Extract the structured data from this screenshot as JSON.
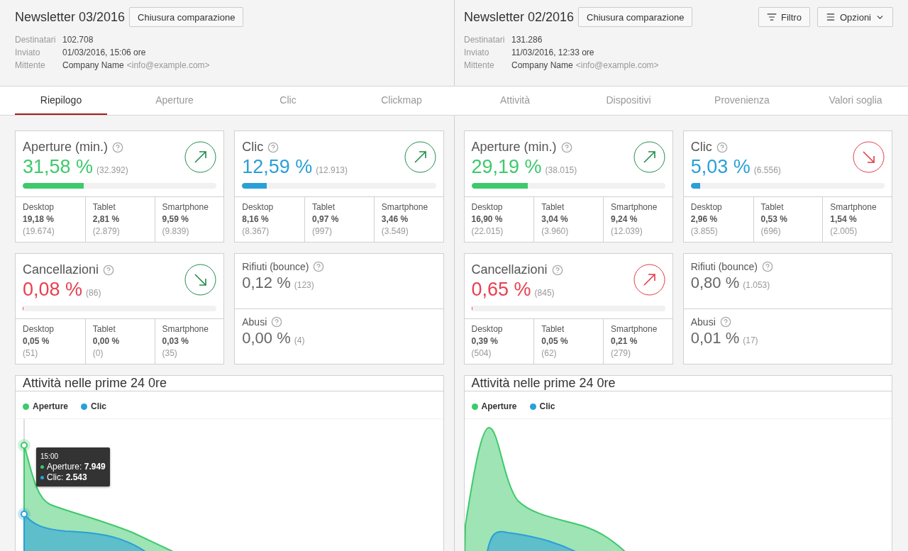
{
  "toolbar": {
    "filter": "Filtro",
    "options": "Opzioni"
  },
  "tabs": [
    {
      "label": "Riepilogo",
      "selected": true
    },
    {
      "label": "Aperture",
      "selected": false
    },
    {
      "label": "Clic",
      "selected": false
    },
    {
      "label": "Clickmap",
      "selected": false
    },
    {
      "label": "Attività",
      "selected": false
    },
    {
      "label": "Dispositivi",
      "selected": false
    },
    {
      "label": "Provenienza",
      "selected": false
    },
    {
      "label": "Valori soglia",
      "selected": false
    }
  ],
  "comparisons": [
    {
      "title": "Newsletter 03/2016",
      "close_button": "Chiusura comparazione",
      "meta": [
        {
          "label": "Destinatari",
          "value": "102.708"
        },
        {
          "label": "Inviato",
          "value": "01/03/2016, 15:06 ore"
        },
        {
          "label": "Mittente",
          "value": "Company Name",
          "extra": "<info@example.com>"
        }
      ],
      "stats": [
        {
          "kind": "metric",
          "title": "Aperture (min.)",
          "value": "31,58 %",
          "count": "(32.392)",
          "color": "#3ec96b",
          "level": 0.3158,
          "trend_up": true,
          "trend_positive": true,
          "devices": [
            {
              "name": "Desktop",
              "percent": "19,18 %",
              "count": "(19.674)"
            },
            {
              "name": "Tablet",
              "percent": "2,81 %",
              "count": "(2.879)"
            },
            {
              "name": "Smartphone",
              "percent": "9,59 %",
              "count": "(9.839)"
            }
          ]
        },
        {
          "kind": "metric",
          "title": "Clic",
          "value": "12,59 %",
          "count": "(12.913)",
          "color": "#2a9fd8",
          "level": 0.1259,
          "trend_up": true,
          "trend_positive": true,
          "devices": [
            {
              "name": "Desktop",
              "percent": "8,16 %",
              "count": "(8.367)"
            },
            {
              "name": "Tablet",
              "percent": "0,97 %",
              "count": "(997)"
            },
            {
              "name": "Smartphone",
              "percent": "3,46 %",
              "count": "(3.549)"
            }
          ]
        },
        {
          "kind": "metric",
          "title": "Cancellazioni",
          "value": "0,08 %",
          "count": "(86)",
          "color": "#e8404f",
          "level": 0.0008,
          "trend_up": false,
          "trend_positive": true,
          "devices": [
            {
              "name": "Desktop",
              "percent": "0,05 %",
              "count": "(51)"
            },
            {
              "name": "Tablet",
              "percent": "0,00 %",
              "count": "(0)"
            },
            {
              "name": "Smartphone",
              "percent": "0,03 %",
              "count": "(35)"
            }
          ]
        },
        {
          "kind": "quality",
          "items": [
            {
              "label": "Rifiuti (bounce)",
              "value": "0,12 %",
              "count": "(123)"
            },
            {
              "label": "Abusi",
              "value": "0,00 %",
              "count": "(4)"
            }
          ]
        }
      ],
      "chart": {
        "title": "Attività nelle prime 24 0re",
        "peaked": false,
        "legend": [
          {
            "label": "Aperture",
            "color": "#3ec96b"
          },
          {
            "label": "Clic",
            "color": "#2a9fd8"
          }
        ],
        "tooltip": {
          "time": "15:00",
          "entries": [
            {
              "text": "Aperture: **7.949**",
              "color": "#3ec96b"
            },
            {
              "text": "Clic: **2.543**",
              "color": "#2a9fd8"
            }
          ]
        }
      }
    },
    {
      "title": "Newsletter 02/2016",
      "close_button": "Chiusura comparazione",
      "meta": [
        {
          "label": "Destinatari",
          "value": "131.286"
        },
        {
          "label": "Inviato",
          "value": "11/03/2016, 12:33 ore"
        },
        {
          "label": "Mittente",
          "value": "Company Name",
          "extra": "<info@example.com>"
        }
      ],
      "stats": [
        {
          "kind": "metric",
          "title": "Aperture (min.)",
          "value": "29,19 %",
          "count": "(38.015)",
          "color": "#3ec96b",
          "level": 0.2919,
          "trend_up": true,
          "trend_positive": true,
          "devices": [
            {
              "name": "Desktop",
              "percent": "16,90 %",
              "count": "(22.015)"
            },
            {
              "name": "Tablet",
              "percent": "3,04 %",
              "count": "(3.960)"
            },
            {
              "name": "Smartphone",
              "percent": "9,24 %",
              "count": "(12.039)"
            }
          ]
        },
        {
          "kind": "metric",
          "title": "Clic",
          "value": "5,03 %",
          "count": "(6.556)",
          "color": "#2a9fd8",
          "level": 0.0503,
          "trend_up": false,
          "trend_positive": false,
          "devices": [
            {
              "name": "Desktop",
              "percent": "2,96 %",
              "count": "(3.855)"
            },
            {
              "name": "Tablet",
              "percent": "0,53 %",
              "count": "(696)"
            },
            {
              "name": "Smartphone",
              "percent": "1,54 %",
              "count": "(2.005)"
            }
          ]
        },
        {
          "kind": "metric",
          "title": "Cancellazioni",
          "value": "0,65 %",
          "count": "(845)",
          "color": "#e8404f",
          "level": 0.0065,
          "trend_up": true,
          "trend_positive": false,
          "devices": [
            {
              "name": "Desktop",
              "percent": "0,39 %",
              "count": "(504)"
            },
            {
              "name": "Tablet",
              "percent": "0,05 %",
              "count": "(62)"
            },
            {
              "name": "Smartphone",
              "percent": "0,21 %",
              "count": "(279)"
            }
          ]
        },
        {
          "kind": "quality",
          "items": [
            {
              "label": "Rifiuti (bounce)",
              "value": "0,80 %",
              "count": "(1.053)"
            },
            {
              "label": "Abusi",
              "value": "0,01 %",
              "count": "(17)"
            }
          ]
        }
      ],
      "chart": {
        "title": "Attività nelle prime 24 0re",
        "peaked": true,
        "legend": [
          {
            "label": "Aperture",
            "color": "#3ec96b"
          },
          {
            "label": "Clic",
            "color": "#2a9fd8"
          }
        ]
      }
    }
  ]
}
